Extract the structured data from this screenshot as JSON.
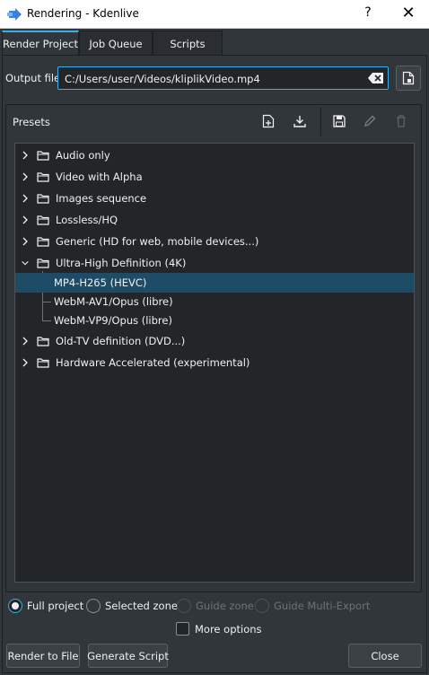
{
  "window": {
    "title": "Rendering - Kdenlive",
    "help_glyph": "?",
    "close_glyph": "✕"
  },
  "tabs": [
    {
      "label": "Render Project",
      "active": true
    },
    {
      "label": "Job Queue",
      "active": false
    },
    {
      "label": "Scripts",
      "active": false
    }
  ],
  "output": {
    "label": "Output file",
    "value": "C:/Users/user/Videos/kliplikVideo.mp4"
  },
  "presets": {
    "label": "Presets",
    "toolbar_icons": [
      "new-preset-icon",
      "download-icon",
      "save-icon",
      "edit-icon",
      "delete-icon"
    ],
    "tree": [
      {
        "label": "Audio only",
        "expanded": false
      },
      {
        "label": "Video with Alpha",
        "expanded": false
      },
      {
        "label": "Images sequence",
        "expanded": false
      },
      {
        "label": "Lossless/HQ",
        "expanded": false
      },
      {
        "label": "Generic (HD for web, mobile devices...)",
        "expanded": false
      },
      {
        "label": "Ultra-High Definition (4K)",
        "expanded": true
      },
      {
        "label": "MP4-H265 (HEVC)",
        "child": true,
        "selected": true
      },
      {
        "label": "WebM-AV1/Opus (libre)",
        "child": true
      },
      {
        "label": "WebM-VP9/Opus (libre)",
        "child": true
      },
      {
        "label": "Old-TV definition (DVD...)",
        "expanded": false
      },
      {
        "label": "Hardware Accelerated (experimental)",
        "expanded": false
      }
    ]
  },
  "range": {
    "options": [
      {
        "label": "Full project",
        "checked": true,
        "enabled": true
      },
      {
        "label": "Selected zone",
        "checked": false,
        "enabled": true
      },
      {
        "label": "Guide zone",
        "checked": false,
        "enabled": false
      },
      {
        "label": "Guide Multi-Export",
        "checked": false,
        "enabled": false
      }
    ]
  },
  "more_options": {
    "label": "More options",
    "checked": false
  },
  "buttons": {
    "render": "Render to File",
    "generate": "Generate Script",
    "close": "Close"
  },
  "colors": {
    "background": "#31363b",
    "field": "#232629",
    "accent": "#3daee9",
    "selection": "#1e4c66"
  }
}
